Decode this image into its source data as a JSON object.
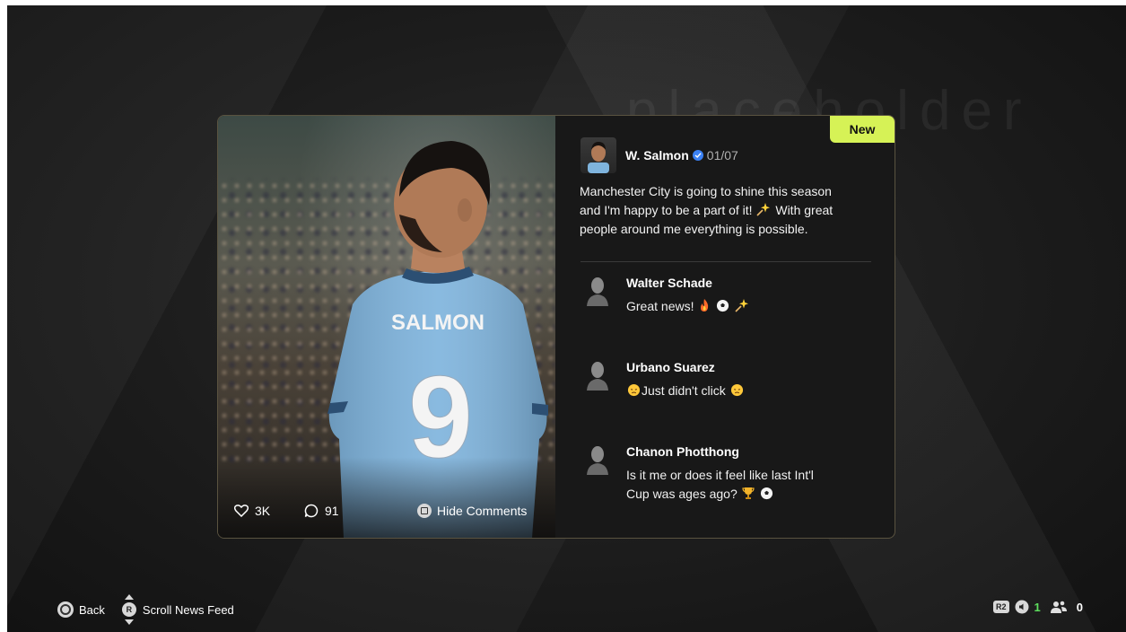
{
  "background": {
    "watermark": "placeholder"
  },
  "post": {
    "badge": "New",
    "author_name": "W. Salmon",
    "date": "01/07",
    "text_line1": "Manchester City is going to shine this season",
    "text_line2a": "and I'm happy to be a part of it!",
    "text_line2b": "With great",
    "text_line3": "people around me everything is possible.",
    "likes": "3K",
    "comments_count": "91",
    "hide_comments_label": "Hide Comments",
    "jersey_name": "SALMON",
    "jersey_number": "9"
  },
  "comments": [
    {
      "name": "Walter Schade",
      "text": "Great news!"
    },
    {
      "name": "Urbano Suarez",
      "text": "Just didn't click"
    },
    {
      "name": "Chanon Photthong",
      "text_line1": "Is it me or does it feel like last Int'l",
      "text_line2": "Cup was ages ago?"
    }
  ],
  "footer": {
    "back_label": "Back",
    "scroll_label": "Scroll News Feed",
    "r_button": "R",
    "r2_label": "R2",
    "count_green": "1",
    "party_count": "0"
  },
  "colors": {
    "accent_new": "#d6f256",
    "verified": "#3b82f6",
    "online_green": "#5ee05e"
  }
}
